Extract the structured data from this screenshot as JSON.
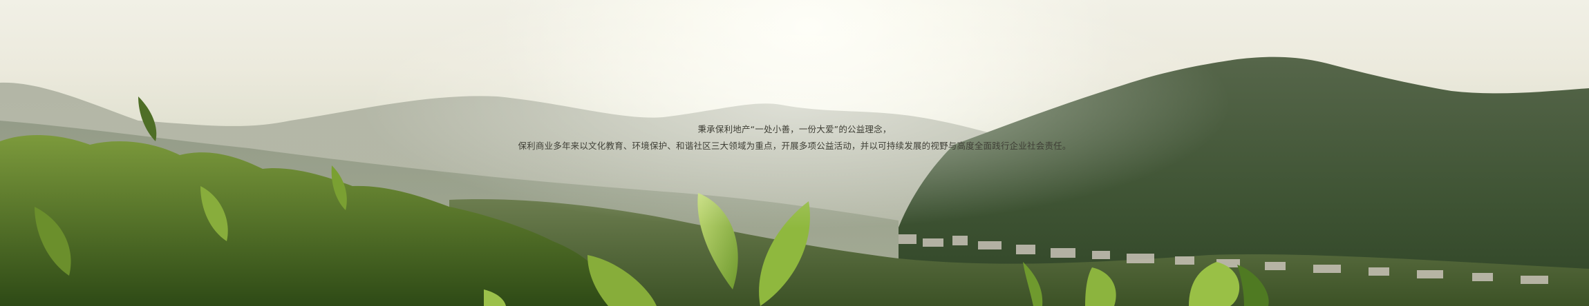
{
  "banner": {
    "lines": [
      "秉承保利地产“一处小善，一份大爱”的公益理念，",
      "保利商业多年来以文化教育、环境保护、和谐社区三大领域为重点，开展多项公益活动，并以可持续发展的视野与高度全面践行企业社会责任。"
    ]
  }
}
